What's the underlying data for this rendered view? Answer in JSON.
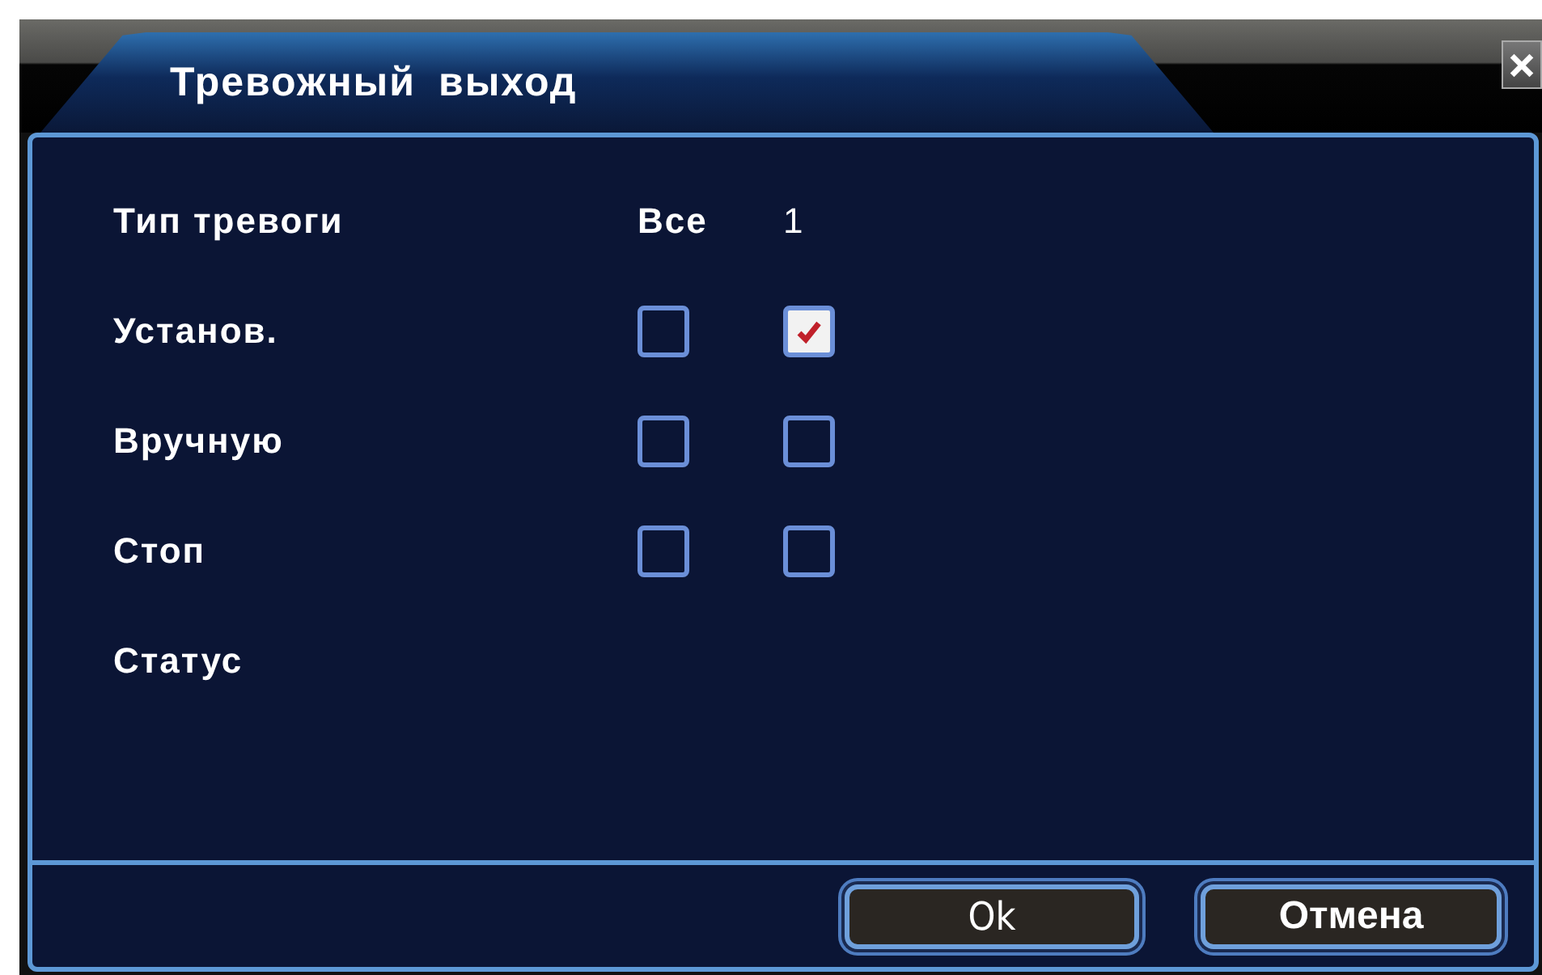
{
  "window": {
    "title": "Тревожный выход"
  },
  "header": {
    "label": "Тип тревоги",
    "columns": [
      "Все",
      "1"
    ]
  },
  "rows": [
    {
      "label": "Установ.",
      "checks": [
        false,
        true
      ]
    },
    {
      "label": "Вручную",
      "checks": [
        false,
        false
      ]
    },
    {
      "label": "Стоп",
      "checks": [
        false,
        false
      ]
    }
  ],
  "status": {
    "label": "Статус"
  },
  "buttons": [
    {
      "label": "Ok"
    },
    {
      "label": "Отмена"
    }
  ]
}
